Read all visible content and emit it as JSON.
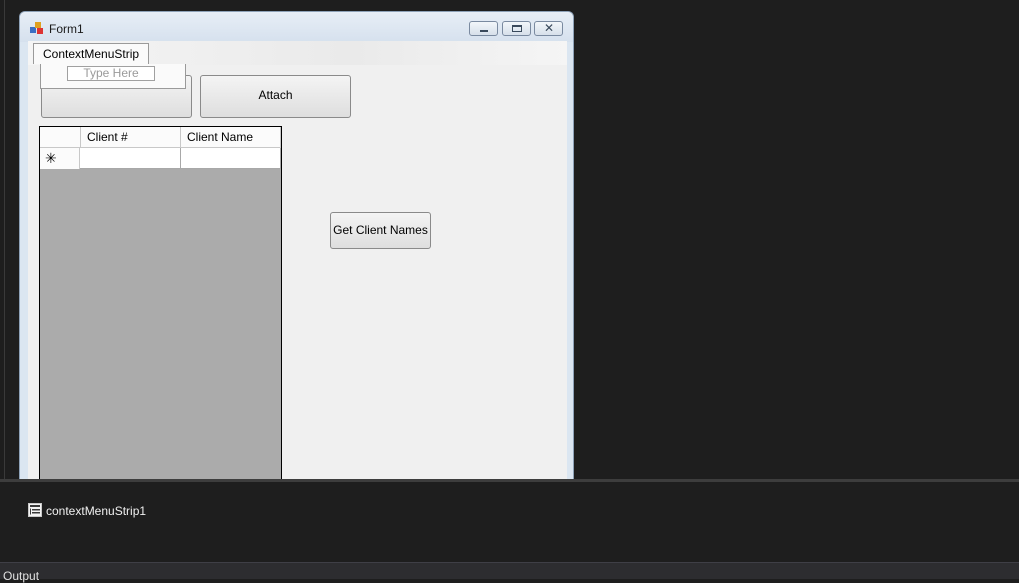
{
  "form": {
    "title": "Form1",
    "menu_strip_label": "ContextMenuStrip",
    "type_here_placeholder": "Type Here",
    "attach_button": "Attach",
    "get_client_names_button": "Get Client Names",
    "grid": {
      "columns": [
        "Client #",
        "Client Name"
      ],
      "new_row_glyph": "✳"
    }
  },
  "tray": {
    "component_name": "contextMenuStrip1"
  },
  "bottom": {
    "output_tab": "Output"
  },
  "colors": {
    "ide_background": "#1e1e1e",
    "form_client": "#f0f0f0",
    "grid_background": "#ababab"
  }
}
